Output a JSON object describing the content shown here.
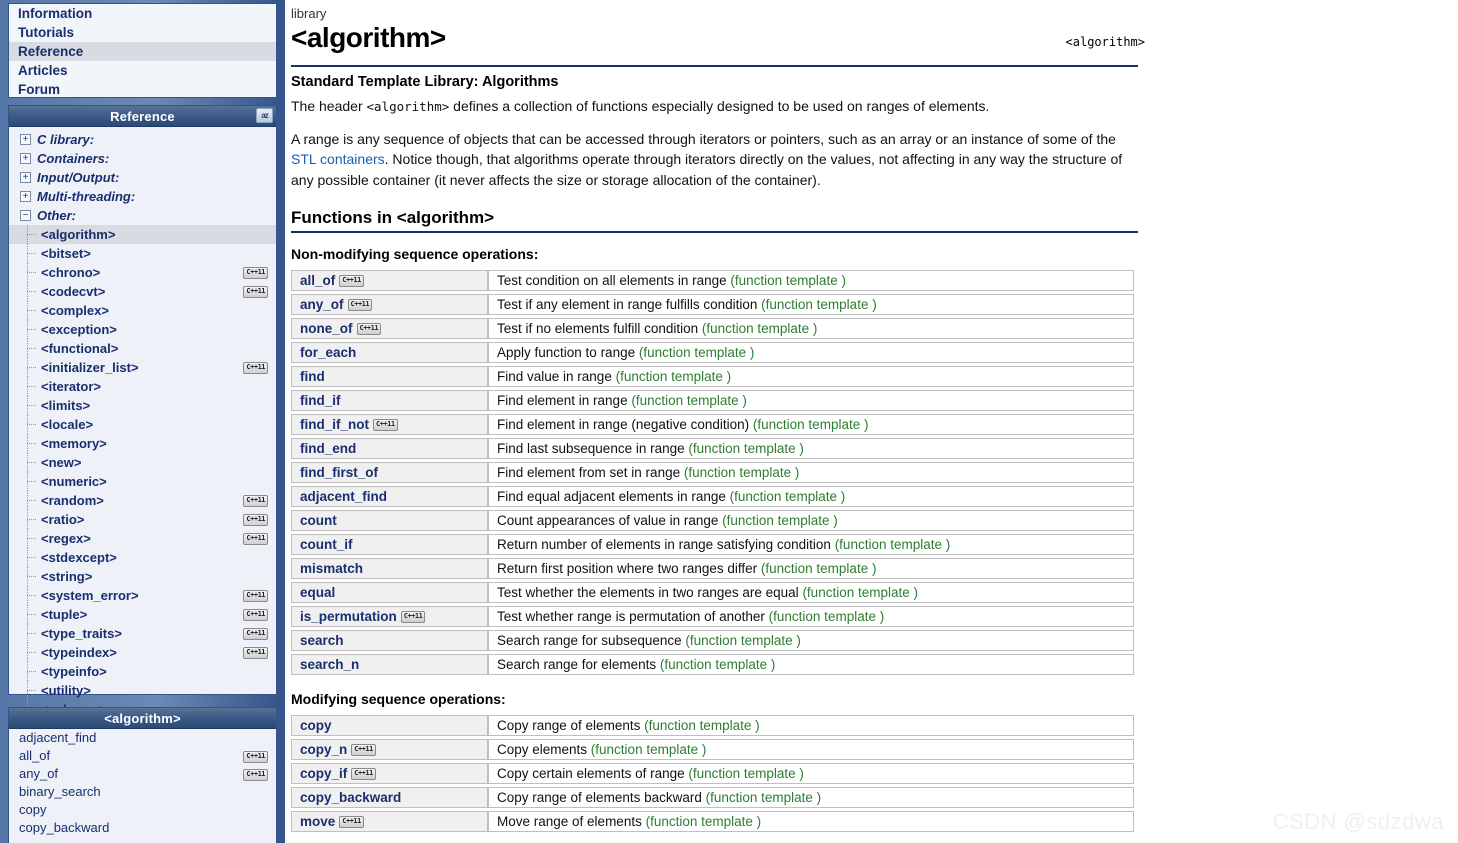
{
  "topnav": {
    "items": [
      {
        "label": "Information",
        "selected": false
      },
      {
        "label": "Tutorials",
        "selected": false
      },
      {
        "label": "Reference",
        "selected": true
      },
      {
        "label": "Articles",
        "selected": false
      },
      {
        "label": "Forum",
        "selected": false
      }
    ]
  },
  "reference_panel": {
    "title": "Reference",
    "sort_icon_label": "az",
    "groups": [
      {
        "label": "C library:",
        "expanded": false,
        "marker": "+"
      },
      {
        "label": "Containers:",
        "expanded": false,
        "marker": "+"
      },
      {
        "label": "Input/Output:",
        "expanded": false,
        "marker": "+"
      },
      {
        "label": "Multi-threading:",
        "expanded": false,
        "marker": "+"
      },
      {
        "label": "Other:",
        "expanded": true,
        "marker": "−"
      }
    ],
    "other_items": [
      {
        "label": "<algorithm>",
        "selected": true,
        "cpp11": false
      },
      {
        "label": "<bitset>",
        "selected": false,
        "cpp11": false
      },
      {
        "label": "<chrono>",
        "selected": false,
        "cpp11": true
      },
      {
        "label": "<codecvt>",
        "selected": false,
        "cpp11": true
      },
      {
        "label": "<complex>",
        "selected": false,
        "cpp11": false
      },
      {
        "label": "<exception>",
        "selected": false,
        "cpp11": false
      },
      {
        "label": "<functional>",
        "selected": false,
        "cpp11": false
      },
      {
        "label": "<initializer_list>",
        "selected": false,
        "cpp11": true
      },
      {
        "label": "<iterator>",
        "selected": false,
        "cpp11": false
      },
      {
        "label": "<limits>",
        "selected": false,
        "cpp11": false
      },
      {
        "label": "<locale>",
        "selected": false,
        "cpp11": false
      },
      {
        "label": "<memory>",
        "selected": false,
        "cpp11": false
      },
      {
        "label": "<new>",
        "selected": false,
        "cpp11": false
      },
      {
        "label": "<numeric>",
        "selected": false,
        "cpp11": false
      },
      {
        "label": "<random>",
        "selected": false,
        "cpp11": true
      },
      {
        "label": "<ratio>",
        "selected": false,
        "cpp11": true
      },
      {
        "label": "<regex>",
        "selected": false,
        "cpp11": true
      },
      {
        "label": "<stdexcept>",
        "selected": false,
        "cpp11": false
      },
      {
        "label": "<string>",
        "selected": false,
        "cpp11": false
      },
      {
        "label": "<system_error>",
        "selected": false,
        "cpp11": true
      },
      {
        "label": "<tuple>",
        "selected": false,
        "cpp11": true
      },
      {
        "label": "<type_traits>",
        "selected": false,
        "cpp11": true
      },
      {
        "label": "<typeindex>",
        "selected": false,
        "cpp11": true
      },
      {
        "label": "<typeinfo>",
        "selected": false,
        "cpp11": false
      },
      {
        "label": "<utility>",
        "selected": false,
        "cpp11": false
      },
      {
        "label": "<valarray>",
        "selected": false,
        "cpp11": false
      }
    ]
  },
  "algorithm_panel": {
    "title": "<algorithm>",
    "items": [
      {
        "label": "adjacent_find",
        "cpp11": false
      },
      {
        "label": "all_of",
        "cpp11": true
      },
      {
        "label": "any_of",
        "cpp11": true
      },
      {
        "label": "binary_search",
        "cpp11": false
      },
      {
        "label": "copy",
        "cpp11": false
      },
      {
        "label": "copy_backward",
        "cpp11": false
      }
    ]
  },
  "main": {
    "breadcrumb": "library",
    "title": "<algorithm>",
    "title_right": "<algorithm>",
    "subtitle": "Standard Template Library: Algorithms",
    "intro_p1_before": "The header ",
    "intro_p1_code": "<algorithm>",
    "intro_p1_after": " defines a collection of functions especially designed to be used on ranges of elements.",
    "intro_p2_before": "A range is any sequence of objects that can be accessed through iterators or pointers, such as an array or an instance of some of the ",
    "intro_p2_link": "STL containers",
    "intro_p2_after": ". Notice though, that algorithms operate through iterators directly on the values, not affecting in any way the structure of any possible container (it never affects the size or storage allocation of the container).",
    "section_heading": "Functions in <algorithm>",
    "cpp11_badge": "C++11",
    "function_template_label": "(function template )",
    "groups": [
      {
        "heading": "Non-modifying sequence operations:",
        "rows": [
          {
            "name": "all_of",
            "cpp11": true,
            "desc": "Test condition on all elements in range ",
            "type": "(function template )"
          },
          {
            "name": "any_of",
            "cpp11": true,
            "desc": "Test if any element in range fulfills condition ",
            "type": "(function template )"
          },
          {
            "name": "none_of",
            "cpp11": true,
            "desc": "Test if no elements fulfill condition ",
            "type": "(function template )"
          },
          {
            "name": "for_each",
            "cpp11": false,
            "desc": "Apply function to range ",
            "type": "(function template )"
          },
          {
            "name": "find",
            "cpp11": false,
            "desc": "Find value in range ",
            "type": "(function template )"
          },
          {
            "name": "find_if",
            "cpp11": false,
            "desc": "Find element in range ",
            "type": "(function template )"
          },
          {
            "name": "find_if_not",
            "cpp11": true,
            "desc": "Find element in range (negative condition) ",
            "type": "(function template )"
          },
          {
            "name": "find_end",
            "cpp11": false,
            "desc": "Find last subsequence in range ",
            "type": "(function template )"
          },
          {
            "name": "find_first_of",
            "cpp11": false,
            "desc": "Find element from set in range ",
            "type": "(function template )"
          },
          {
            "name": "adjacent_find",
            "cpp11": false,
            "desc": "Find equal adjacent elements in range ",
            "type": "(function template )"
          },
          {
            "name": "count",
            "cpp11": false,
            "desc": "Count appearances of value in range ",
            "type": "(function template )"
          },
          {
            "name": "count_if",
            "cpp11": false,
            "desc": "Return number of elements in range satisfying condition ",
            "type": "(function template )"
          },
          {
            "name": "mismatch",
            "cpp11": false,
            "desc": "Return first position where two ranges differ ",
            "type": "(function template )"
          },
          {
            "name": "equal",
            "cpp11": false,
            "desc": "Test whether the elements in two ranges are equal ",
            "type": "(function template )"
          },
          {
            "name": "is_permutation",
            "cpp11": true,
            "desc": "Test whether range is permutation of another ",
            "type": "(function template )"
          },
          {
            "name": "search",
            "cpp11": false,
            "desc": "Search range for subsequence ",
            "type": "(function template )"
          },
          {
            "name": "search_n",
            "cpp11": false,
            "desc": "Search range for elements ",
            "type": "(function template )"
          }
        ]
      },
      {
        "heading": "Modifying sequence operations:",
        "rows": [
          {
            "name": "copy",
            "cpp11": false,
            "desc": "Copy range of elements ",
            "type": "(function template )"
          },
          {
            "name": "copy_n",
            "cpp11": true,
            "desc": "Copy elements ",
            "type": "(function template )"
          },
          {
            "name": "copy_if",
            "cpp11": true,
            "desc": "Copy certain elements of range ",
            "type": "(function template )"
          },
          {
            "name": "copy_backward",
            "cpp11": false,
            "desc": "Copy range of elements backward ",
            "type": "(function template )"
          },
          {
            "name": "move",
            "cpp11": true,
            "desc": "Move range of elements ",
            "type": "(function template )"
          }
        ]
      }
    ]
  },
  "watermark": "CSDN @sdzdwa",
  "colors": {
    "accent": "#1a2e6e",
    "panel_header_bg": "#2c4a75",
    "selected_row": "#d8dce2",
    "link": "#1a5fb4",
    "function_type": "#2e7d32",
    "rail": "#5577a8"
  }
}
